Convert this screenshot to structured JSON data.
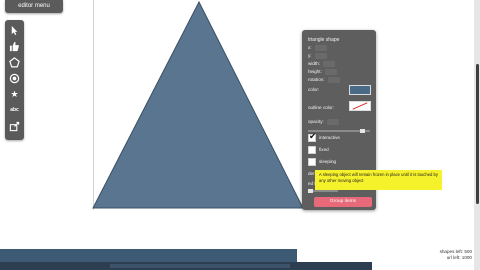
{
  "editor_menu": {
    "label": "editor menu"
  },
  "toolbar": {
    "tools": [
      {
        "name": "pointer-icon",
        "glyph": ""
      },
      {
        "name": "thumbs-up-icon",
        "glyph": ""
      },
      {
        "name": "pentagon-icon",
        "glyph": ""
      },
      {
        "name": "circle-icon",
        "glyph": ""
      },
      {
        "name": "star-icon",
        "glyph": "★"
      },
      {
        "name": "text-tool",
        "glyph": "abc"
      },
      {
        "name": "export-icon",
        "glyph": ""
      }
    ]
  },
  "shape": {
    "type": "triangle",
    "fill": "#5a7590",
    "outline": "#3b5063"
  },
  "properties": {
    "title": "triangle shape",
    "x_label": "x:",
    "x_value": "",
    "y_label": "y:",
    "y_value": "",
    "width_label": "width:",
    "width_value": "",
    "height_label": "height:",
    "height_value": "",
    "rotation_label": "rotation:",
    "rotation_value": "",
    "color_label": "color:",
    "color_value": "#4a6b88",
    "outline_label": "outline color:",
    "opacity_label": "opacity:",
    "opacity_value": "",
    "interactive_label": "interactive",
    "interactive_checked": true,
    "fixed_label": "fixed",
    "fixed_checked": false,
    "sleeping_label": "sleeping",
    "sleeping_checked": false,
    "density_label": "density:",
    "bounce_label": "ed bounce:",
    "group_button": "Group items"
  },
  "tooltip": {
    "text": "A sleeping object will remain frozen in place until it is touched by any other moving object"
  },
  "status": {
    "shapes_left": "shapes left: 500",
    "url_left": "url left: 1000"
  },
  "colors": {
    "panel": "#5e5e5e",
    "accent": "#e86a7a",
    "tooltip": "#f5f12a",
    "bottom_bar": "#3d5a74"
  }
}
